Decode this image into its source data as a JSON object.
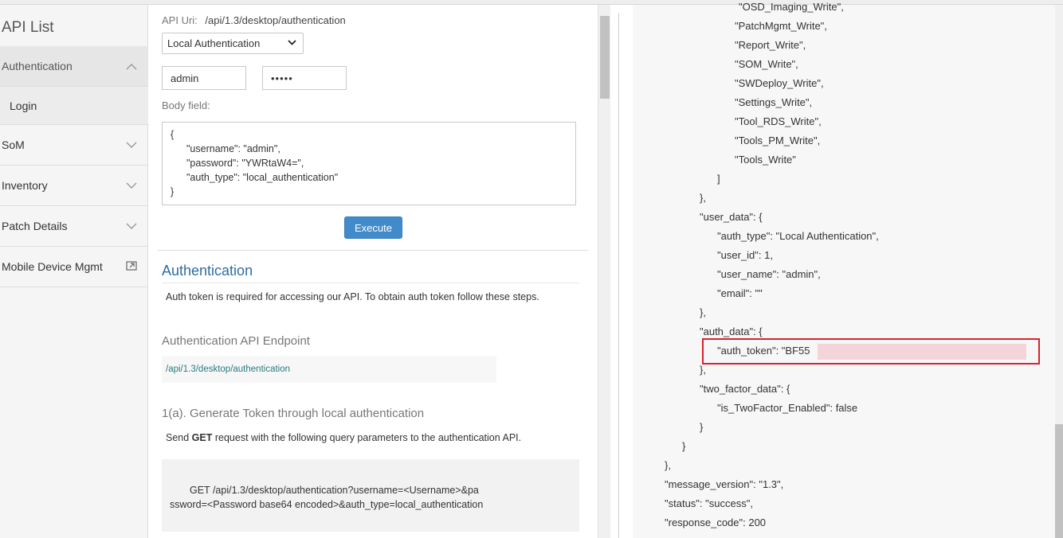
{
  "sidebar": {
    "title": "API List",
    "items": [
      {
        "label": "Authentication",
        "icon": "chevron-up-icon",
        "active": true
      },
      {
        "label": "SoM",
        "icon": "chevron-down-icon"
      },
      {
        "label": "Inventory",
        "icon": "chevron-down-icon"
      },
      {
        "label": "Patch Details",
        "icon": "chevron-down-icon"
      },
      {
        "label": "Mobile Device Mgmt",
        "icon": "external-link-icon"
      }
    ],
    "sub_item": "Login"
  },
  "request": {
    "uri_label": "API Uri:",
    "uri_value": "/api/1.3/desktop/authentication",
    "auth_type_selected": "Local Authentication",
    "username_value": "admin",
    "password_value": "•••••",
    "body_label": "Body field:",
    "body_open": "{",
    "body_username": "\"username\": \"admin\",",
    "body_password": "\"password\": \"YWRtaW4=\",",
    "body_auth_type": "\"auth_type\": \"local_authentication\"",
    "body_close": "}",
    "execute_label": "Execute"
  },
  "docs": {
    "auth_heading": "Authentication",
    "auth_desc": "Auth token is required for accessing our API. To obtain auth token follow these steps.",
    "endpoint_heading": "Authentication API Endpoint",
    "endpoint_value": "/api/1.3/desktop/authentication",
    "gen_heading": "1(a). Generate Token through local authentication",
    "gen_desc_pre": "Send ",
    "gen_desc_bold": "GET",
    "gen_desc_post": " request with the following query parameters to the authentication API.",
    "code_line1": "GET /api/1.3/desktop/authentication?username=<Username>&pa",
    "code_line2": "ssword=<Password base64 encoded>&auth_type=local_authentication"
  },
  "response": {
    "lines": [
      "\"OSD_Imaging_Write\",",
      "\"PatchMgmt_Write\",",
      "\"Report_Write\",",
      "\"SOM_Write\",",
      "\"SWDeploy_Write\",",
      "\"Settings_Write\",",
      "\"Tool_RDS_Write\",",
      "\"Tools_PM_Write\",",
      "\"Tools_Write\"",
      "]",
      "},",
      "\"user_data\": {",
      "\"auth_type\": \"Local Authentication\",",
      "\"user_id\": 1,",
      "\"user_name\": \"admin\",",
      "\"email\": \"\"",
      "},",
      "\"auth_data\": {",
      "\"auth_token\": \"BF55",
      "},",
      "\"two_factor_data\": {",
      "\"is_TwoFactor_Enabled\": false",
      "}",
      "}",
      "},",
      "\"message_version\": \"1.3\",",
      "\"status\": \"success\",",
      "\"response_code\": 200"
    ]
  }
}
